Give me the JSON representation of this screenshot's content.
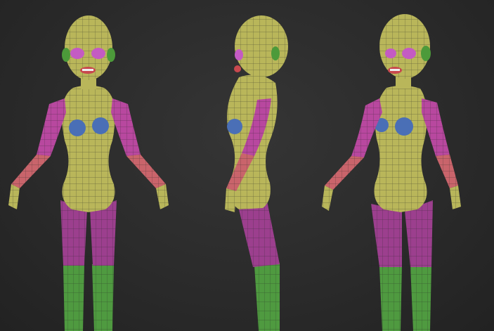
{
  "scene": {
    "background": "#2b2b2b",
    "views": [
      "front",
      "side",
      "three-quarter"
    ],
    "polygroup_colors": {
      "head_torso": "#b9b65a",
      "ears_eyes": "#c45bc3",
      "lips": "#c8484e",
      "upper_arm": "#b8489f",
      "forearm": "#c9646b",
      "hands": "#b8b65a",
      "chest": "#4a6fb6",
      "thigh": "#9c3f8e",
      "boots": "#4f9a40",
      "ear_green": "#4c9a3a"
    }
  }
}
